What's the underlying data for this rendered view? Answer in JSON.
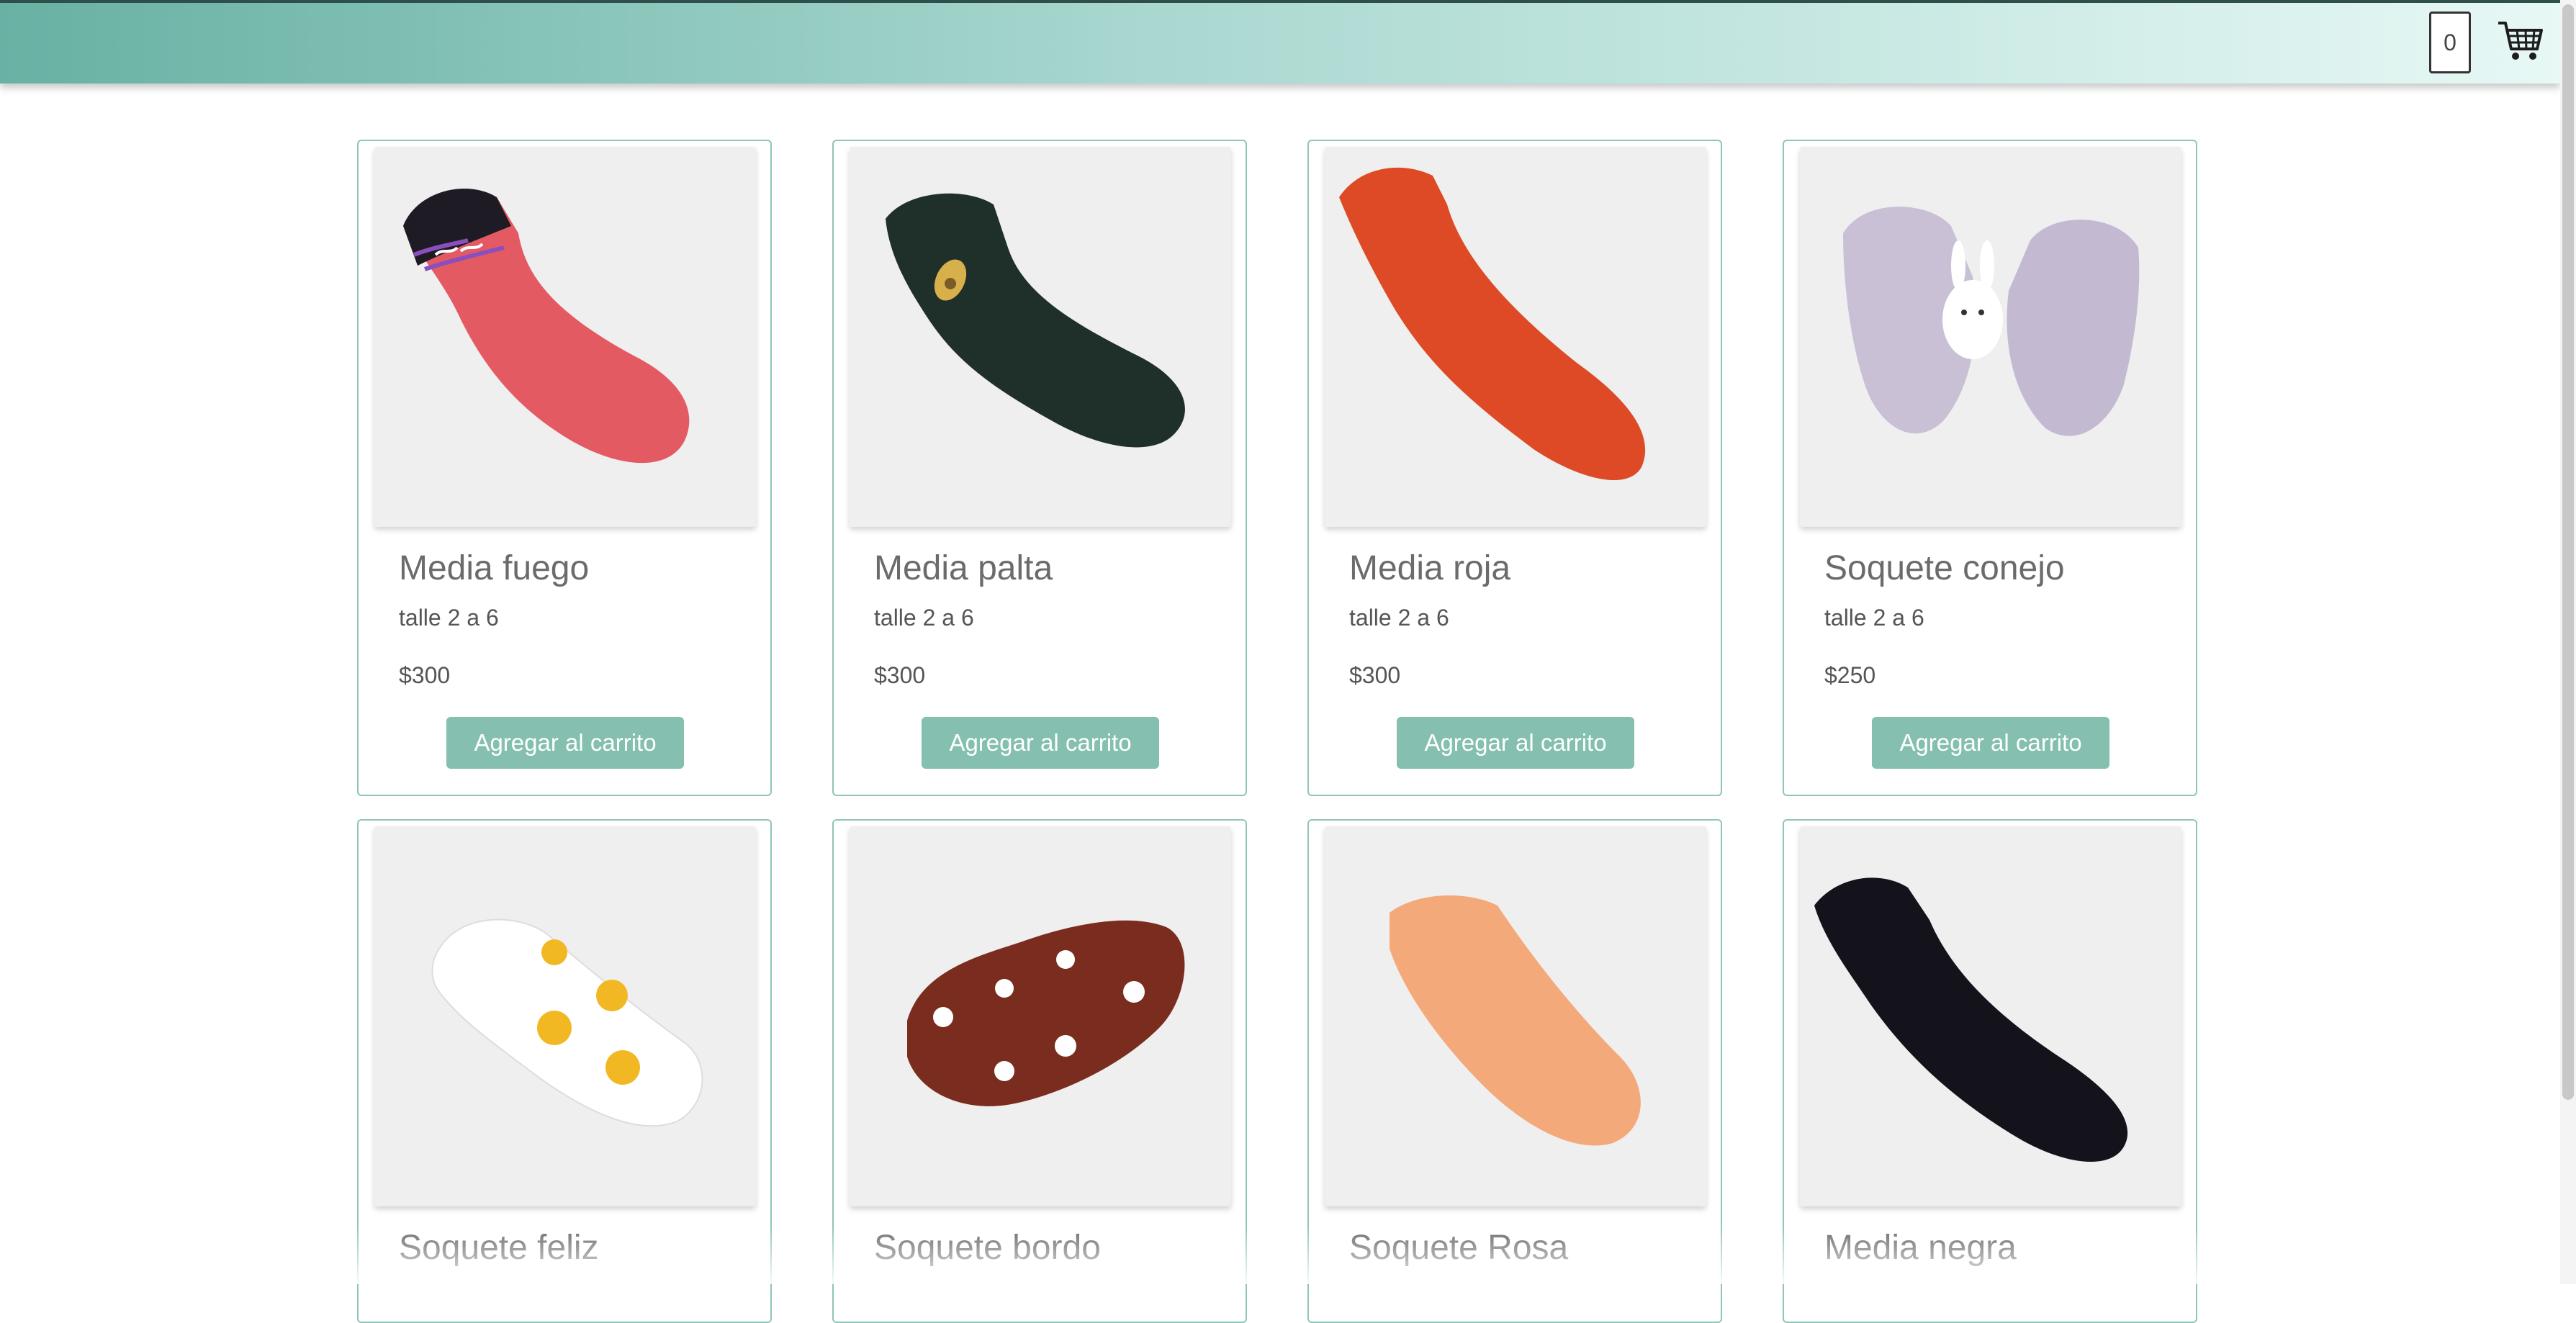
{
  "header": {
    "cart_count": "0",
    "cart_icon": "shopping-cart-icon"
  },
  "theme": {
    "accent": "#84bfaf",
    "header_gradient_start": "#68b1a3",
    "header_gradient_end": "#e7f8f5"
  },
  "products": [
    {
      "name": "Media fuego",
      "size": "talle 2 a 6",
      "price": "$300",
      "button": "Agregar al carrito",
      "image": "red-sock-with-flames"
    },
    {
      "name": "Media palta",
      "size": "talle 2 a 6",
      "price": "$300",
      "button": "Agregar al carrito",
      "image": "dark-green-sock-with-avocado"
    },
    {
      "name": "Media roja",
      "size": "talle 2 a 6",
      "price": "$300",
      "button": "Agregar al carrito",
      "image": "orange-red-sock"
    },
    {
      "name": "Soquete conejo",
      "size": "talle 2 a 6",
      "price": "$250",
      "button": "Agregar al carrito",
      "image": "lilac-socks-with-bunny"
    },
    {
      "name": "Soquete feliz",
      "image": "white-sock-with-smileys"
    },
    {
      "name": "Soquete bordo",
      "image": "burgundy-sock-with-daisies"
    },
    {
      "name": "Soquete Rosa",
      "image": "peach-ankle-sock"
    },
    {
      "name": "Media negra",
      "image": "black-sock"
    }
  ]
}
